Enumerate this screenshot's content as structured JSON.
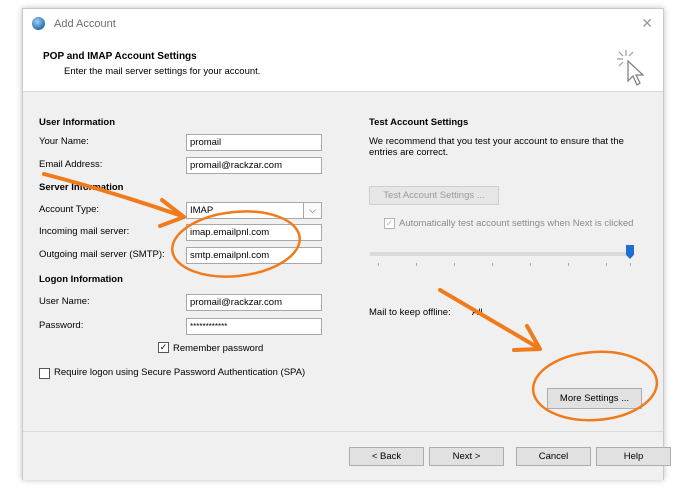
{
  "window": {
    "title": "Add Account"
  },
  "header": {
    "title": "POP and IMAP Account Settings",
    "subtitle": "Enter the mail server settings for your account."
  },
  "left": {
    "user_info": {
      "heading": "User Information",
      "name_label": "Your Name:",
      "name_value": "promail",
      "email_label": "Email Address:",
      "email_value": "promail@rackzar.com"
    },
    "server_info": {
      "heading": "Server Information",
      "account_type_label": "Account Type:",
      "account_type_value": "IMAP",
      "incoming_label": "Incoming mail server:",
      "incoming_value": "imap.emailpnl.com",
      "outgoing_label": "Outgoing mail server (SMTP):",
      "outgoing_value": "smtp.emailpnl.com"
    },
    "logon_info": {
      "heading": "Logon Information",
      "user_label": "User Name:",
      "user_value": "promail@rackzar.com",
      "password_label": "Password:",
      "password_value": "************",
      "remember_label": "Remember password",
      "remember_checked": true,
      "spa_label": "Require logon using Secure Password Authentication (SPA)",
      "spa_checked": false
    }
  },
  "right": {
    "heading": "Test Account Settings",
    "description": "We recommend that you test your account to ensure that the entries are correct.",
    "test_button": "Test Account Settings ...",
    "auto_test_label": "Automatically test account settings when Next is clicked",
    "auto_test_checked": true,
    "offline_label": "Mail to keep offline:",
    "offline_value": "All",
    "offline_level": 1.0,
    "more_settings_button": "More Settings ..."
  },
  "footer": {
    "back": "< Back",
    "next": "Next >",
    "cancel": "Cancel",
    "help": "Help"
  },
  "colors": {
    "annotation": "#f07b1c",
    "slider_thumb": "#1f6fd1"
  }
}
